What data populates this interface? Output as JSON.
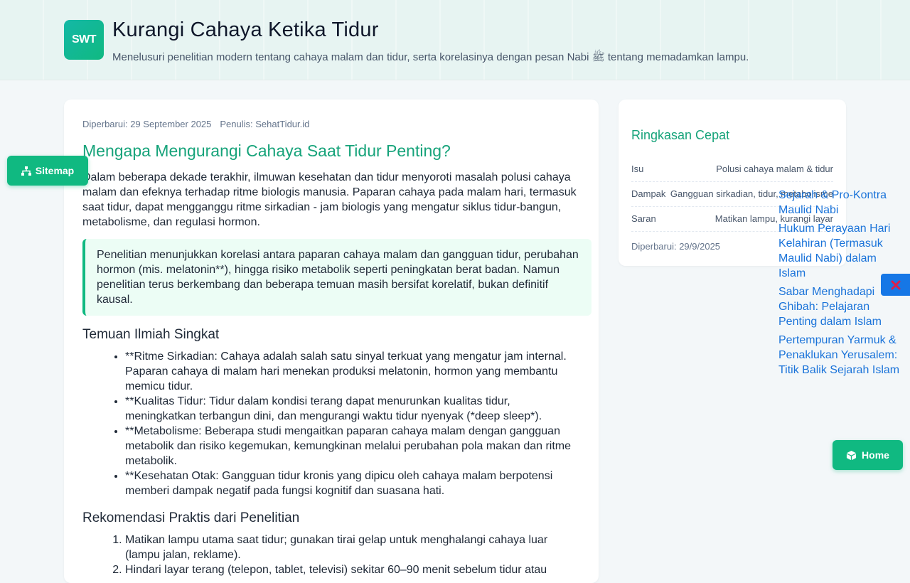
{
  "header": {
    "logo_text": "SWT",
    "title": "Kurangi Cahaya Ketika Tidur",
    "subtitle": "Menelusuri penelitian modern tentang cahaya malam dan tidur, serta korelasinya dengan pesan Nabi ﷺ tentang memadamkan lampu."
  },
  "article": {
    "updated": "Diperbarui: 29 September 2025",
    "author": "Penulis: SehatTidur.id",
    "heading": "Mengapa Mengurangi Cahaya Saat Tidur Penting?",
    "intro": "Dalam beberapa dekade terakhir, ilmuwan kesehatan dan tidur menyoroti masalah polusi cahaya malam dan efeknya terhadap ritme biologis manusia. Paparan cahaya pada malam hari, termasuk saat tidur, dapat mengganggu ritme sirkadian - jam biologis yang mengatur siklus tidur-bangun, metabolisme, dan regulasi hormon.",
    "callout": "Penelitian menunjukkan korelasi antara paparan cahaya malam dan gangguan tidur, perubahan hormon (mis. melatonin**), hingga risiko metabolik seperti peningkatan berat badan. Namun penelitian terus berkembang dan beberapa temuan masih bersifat korelatif, bukan definitif kausal.",
    "findings_heading": "Temuan Ilmiah Singkat",
    "findings": [
      "**Ritme Sirkadian: Cahaya adalah salah satu sinyal terkuat yang mengatur jam internal. Paparan cahaya di malam hari menekan produksi melatonin, hormon yang membantu memicu tidur.",
      "**Kualitas Tidur: Tidur dalam kondisi terang dapat menurunkan kualitas tidur, meningkatkan terbangun dini, dan mengurangi waktu tidur nyenyak (*deep sleep*).",
      "**Metabolisme: Beberapa studi mengaitkan paparan cahaya malam dengan gangguan metabolik dan risiko kegemukan, kemungkinan melalui perubahan pola makan dan ritme metabolik.",
      "**Kesehatan Otak: Gangguan tidur kronis yang dipicu oleh cahaya malam berpotensi memberi dampak negatif pada fungsi kognitif dan suasana hati."
    ],
    "recommend_heading": "Rekomendasi Praktis dari Penelitian",
    "recommendations": [
      "Matikan lampu utama saat tidur; gunakan tirai gelap untuk menghalangi cahaya luar (lampu jalan, reklame).",
      "Hindari layar terang (telepon, tablet, televisi) sekitar 60–90 menit sebelum tidur atau"
    ]
  },
  "summary": {
    "title": "Ringkasan Cepat",
    "rows": [
      {
        "key": "Isu",
        "value": "Polusi cahaya malam & tidur"
      },
      {
        "key": "Dampak",
        "value": "Gangguan sirkadian, tidur, metabolisme"
      },
      {
        "key": "Saran",
        "value": "Matikan lampu, kurangi layar"
      }
    ],
    "updated": "Diperbarui: 29/9/2025"
  },
  "buttons": {
    "sitemap": "Sitemap",
    "home": "Home"
  },
  "related_links": [
    "Sejarah & Pro-Kontra Maulid Nabi",
    "Hukum Perayaan Hari Kelahiran (Termasuk Maulid Nabi) dalam Islam",
    "Sabar Menghadapi Ghibah: Pelajaran Penting dalam Islam",
    "Pertempuran Yarmuk & Penaklukan Yerusalem: Titik Balik Sejarah Islam"
  ],
  "colors": {
    "accent": "#10b981",
    "heading_green": "#16a37a",
    "link_blue": "#1a73d9",
    "close_blue": "#1677e6"
  },
  "icons": {
    "sitemap": "sitemap-icon",
    "home": "box-icon",
    "close": "close-icon"
  }
}
